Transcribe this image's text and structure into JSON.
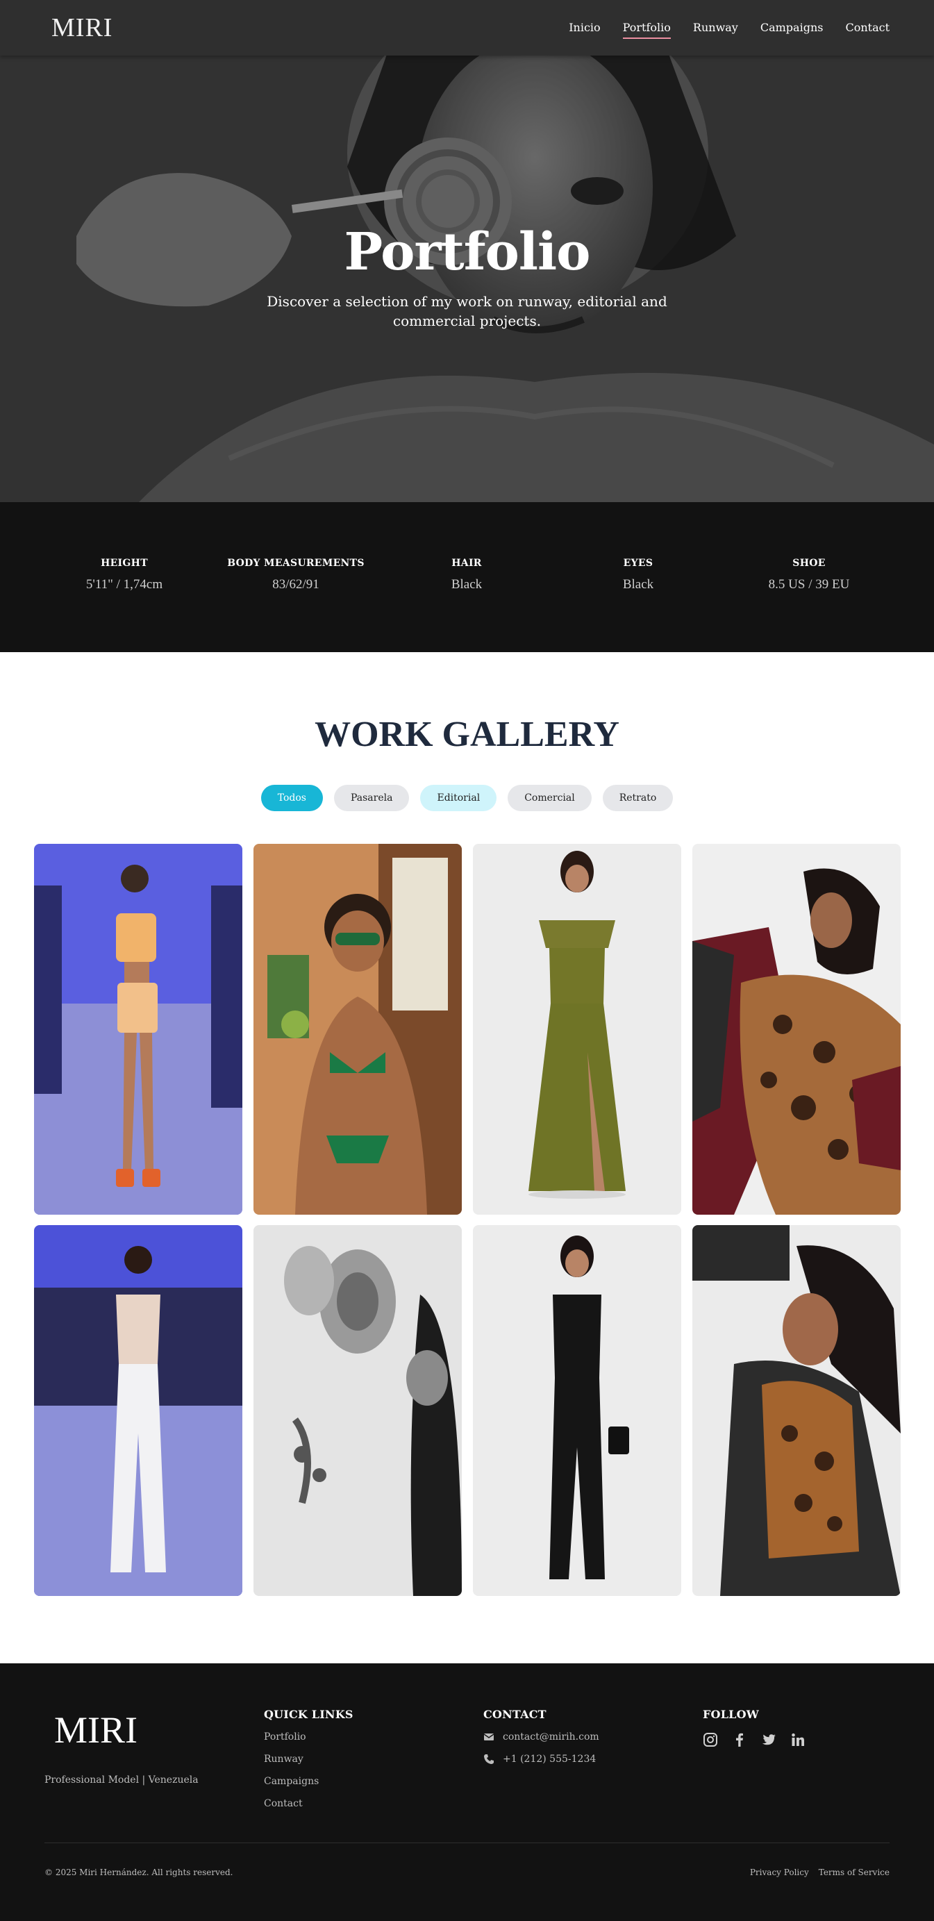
{
  "nav": {
    "logo": "MIRI",
    "links": [
      {
        "label": "Inicio"
      },
      {
        "label": "Portfolio",
        "active": true
      },
      {
        "label": "Runway"
      },
      {
        "label": "Campaigns"
      },
      {
        "label": "Contact"
      }
    ],
    "active_underline_color": "#ec8fa0"
  },
  "hero": {
    "title": "Portfolio",
    "subtitle": "Discover a selection of my work on runway, editorial and commercial projects."
  },
  "stats": [
    {
      "label": "HEIGHT",
      "value": "5'11\" / 1,74cm"
    },
    {
      "label": "BODY MEASUREMENTS",
      "value": "83/62/91"
    },
    {
      "label": "HAIR",
      "value": "Black"
    },
    {
      "label": "EYES",
      "value": "Black"
    },
    {
      "label": "SHOE",
      "value": "8.5 US / 39 EU"
    }
  ],
  "gallery": {
    "title": "WORK GALLERY",
    "filters": [
      {
        "label": "Todos",
        "state": "active"
      },
      {
        "label": "Pasarela",
        "state": "default"
      },
      {
        "label": "Editorial",
        "state": "hover"
      },
      {
        "label": "Comercial",
        "state": "default"
      },
      {
        "label": "Retrato",
        "state": "default"
      }
    ],
    "accent": "#18b6d6",
    "items": [
      "runway-crochet-outfit-photo",
      "bikini-sunglasses-photo",
      "olive-satin-gown-photo",
      "leopard-print-dress-photo",
      "runway-white-jumpsuit-photo",
      "black-and-white-portrait-photo",
      "black-jumpsuit-photo",
      "denim-jacket-leopard-top-photo"
    ]
  },
  "footer": {
    "logo": "MIRI",
    "tagline": "Professional Model | Venezuela",
    "quick_links": {
      "heading": "QUICK LINKS",
      "items": [
        "Portfolio",
        "Runway",
        "Campaigns",
        "Contact"
      ]
    },
    "contact": {
      "heading": "CONTACT",
      "email": "contact@mirih.com",
      "phone": "+1 (212) 555-1234"
    },
    "follow": {
      "heading": "FOLLOW",
      "icons": [
        "instagram-icon",
        "facebook-icon",
        "twitter-icon",
        "linkedin-icon"
      ]
    },
    "copyright": "© 2025 Miri Hernández. All rights reserved.",
    "legal": [
      "Privacy Policy",
      "Terms of Service"
    ]
  }
}
